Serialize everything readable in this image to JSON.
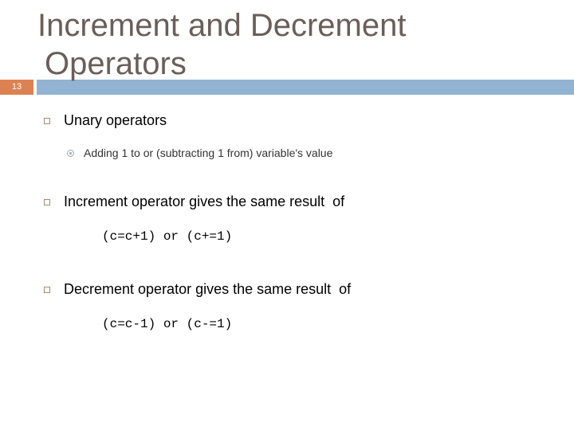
{
  "slide": {
    "number": "13",
    "title_line1": "Increment and Decrement",
    "title_line2": "Operators",
    "colors": {
      "title": "#6b5e58",
      "number_box": "#dc8252",
      "title_bar": "#92b3d1",
      "bullet_square": "#a88a75"
    }
  },
  "content": {
    "bullets": [
      {
        "icon": "square-bullet-icon",
        "text": "Unary operators",
        "sub_bullets": [
          {
            "icon": "circle-bullet-icon",
            "text": "Adding 1 to or (subtracting 1 from) variable's value"
          }
        ]
      },
      {
        "icon": "square-bullet-icon",
        "text": "Increment operator gives the same result  of",
        "code": "(c=c+1) or (c+=1)"
      },
      {
        "icon": "square-bullet-icon",
        "text": "Decrement operator gives the same result  of",
        "code": "(c=c-1) or (c-=1)"
      }
    ]
  }
}
